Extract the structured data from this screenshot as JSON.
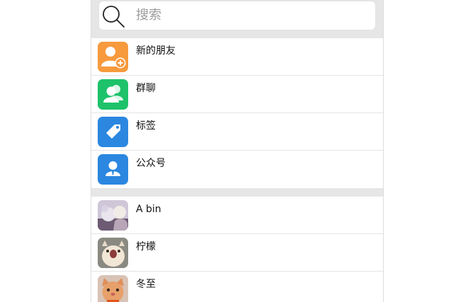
{
  "search": {
    "placeholder": "搜索"
  },
  "function_items": [
    {
      "label": "新的朋友",
      "icon": "add-friend-icon",
      "color": "#f79a3e"
    },
    {
      "label": "群聊",
      "icon": "group-chat-icon",
      "color": "#1ec26a"
    },
    {
      "label": "标签",
      "icon": "tag-icon",
      "color": "#2b87e0"
    },
    {
      "label": "公众号",
      "icon": "official-account-icon",
      "color": "#2b87e0"
    }
  ],
  "contacts": [
    {
      "name": "A bin",
      "avatar": "photo-avatar"
    },
    {
      "name": "柠檬",
      "avatar": "cat-photo-avatar"
    },
    {
      "name": "冬至",
      "avatar": "cat-photo-avatar"
    }
  ],
  "colors": {
    "background": "#e6e6e6",
    "add_friend": "#f79a3e",
    "group_chat": "#1ec26a",
    "tag": "#2b87e0",
    "official_account": "#2b87e0"
  }
}
